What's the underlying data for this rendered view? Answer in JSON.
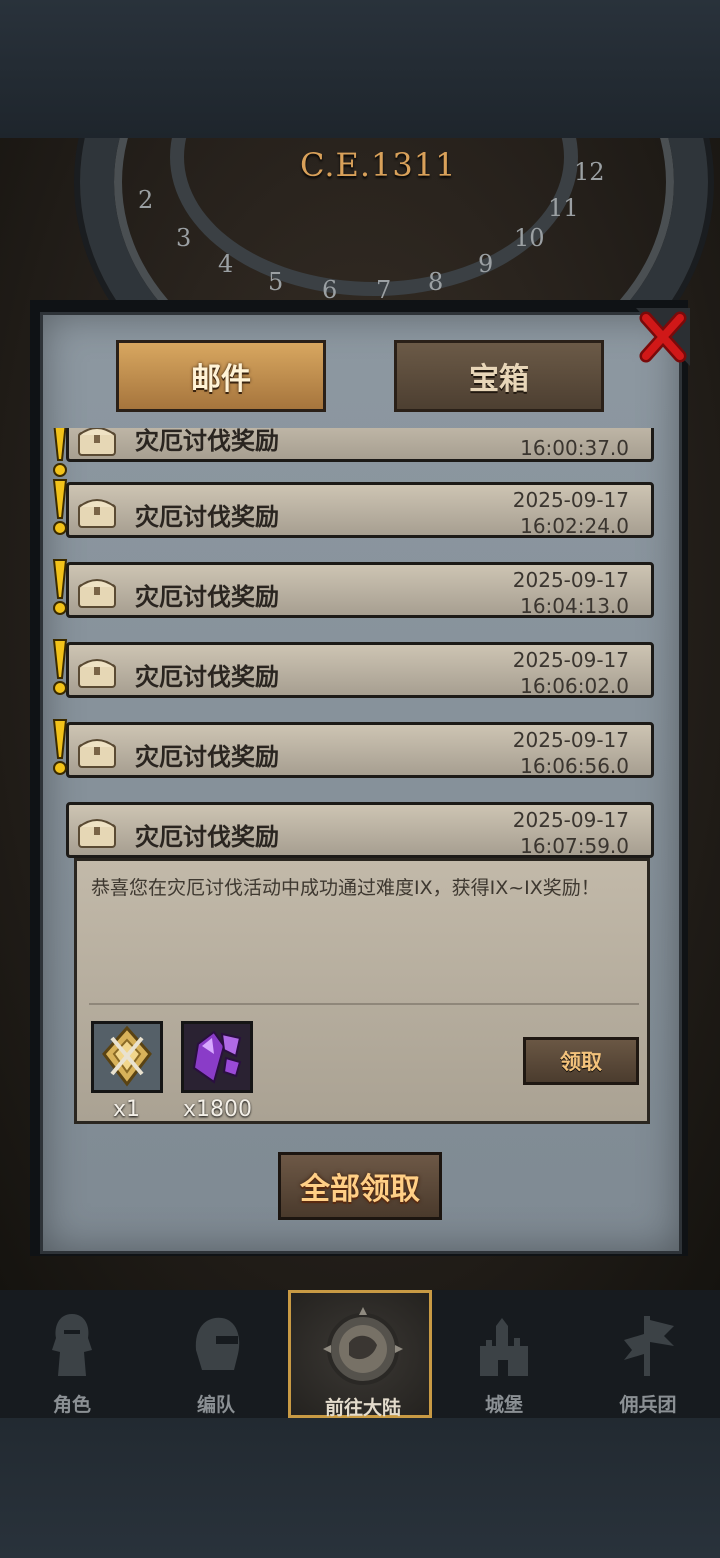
{
  "game": {
    "year": "C.E.1311",
    "month_numbers": [
      "2",
      "3",
      "4",
      "5",
      "6",
      "7",
      "8",
      "9",
      "10",
      "11",
      "12"
    ]
  },
  "tabs": {
    "mail": "邮件",
    "chest": "宝箱"
  },
  "mails": [
    {
      "title": "灾厄讨伐奖励",
      "date": "",
      "time": "16:00:37.0",
      "unread": true
    },
    {
      "title": "灾厄讨伐奖励",
      "date": "2025-09-17",
      "time": "16:02:24.0",
      "unread": true
    },
    {
      "title": "灾厄讨伐奖励",
      "date": "2025-09-17",
      "time": "16:04:13.0",
      "unread": true
    },
    {
      "title": "灾厄讨伐奖励",
      "date": "2025-09-17",
      "time": "16:06:02.0",
      "unread": true
    },
    {
      "title": "灾厄讨伐奖励",
      "date": "2025-09-17",
      "time": "16:06:56.0",
      "unread": true
    },
    {
      "title": "灾厄讨伐奖励",
      "date": "2025-09-17",
      "time": "16:07:59.0",
      "unread": false
    }
  ],
  "detail": {
    "message": "恭喜您在灾厄讨伐活动中成功通过难度IX，获得IX~IX奖励！",
    "rewards": [
      {
        "icon": "medal-icon",
        "count": "x1"
      },
      {
        "icon": "purple-crystal-icon",
        "count": "x1800"
      }
    ],
    "claim_label": "领取"
  },
  "claim_all_label": "全部领取",
  "nav": [
    {
      "label": "角色",
      "icon": "knight-icon"
    },
    {
      "label": "编队",
      "icon": "helmet-icon"
    },
    {
      "label": "前往大陆",
      "icon": "compass-map-icon",
      "active": true
    },
    {
      "label": "城堡",
      "icon": "castle-icon"
    },
    {
      "label": "佣兵团",
      "icon": "banner-icon"
    }
  ],
  "colors": {
    "accent": "#c89a44",
    "close": "#d01818",
    "unread": "#f2c21a"
  }
}
